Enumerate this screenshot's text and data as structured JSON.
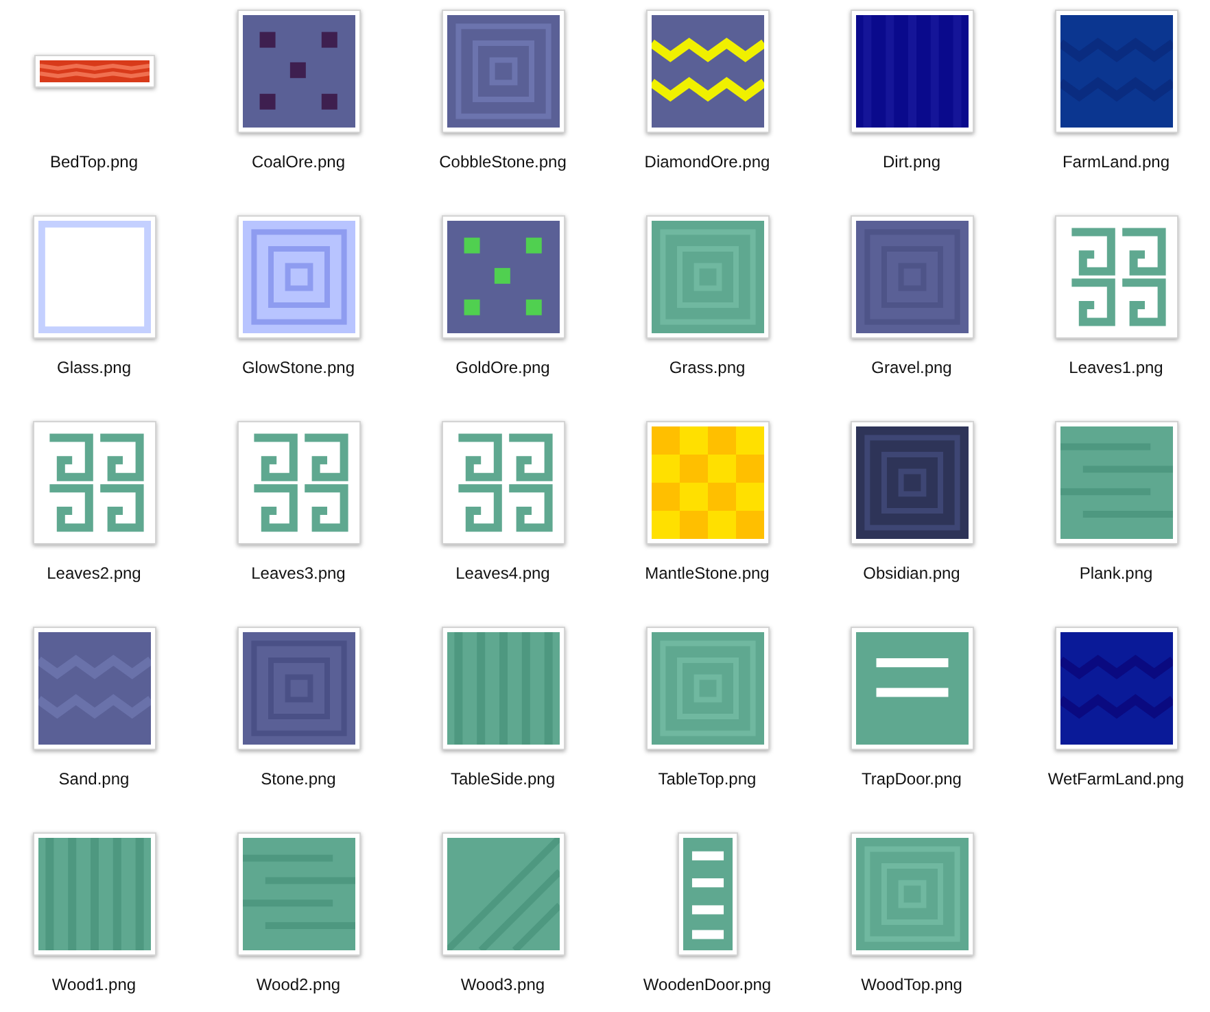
{
  "files": [
    {
      "name": "BedTop.png",
      "kind": "picture"
    },
    {
      "name": "CoalOre.png",
      "kind": "picture"
    },
    {
      "name": "CobbleStone.png",
      "kind": "picture"
    },
    {
      "name": "DiamondOre.png",
      "kind": "picture"
    },
    {
      "name": "Dirt.png",
      "kind": "picture"
    },
    {
      "name": "FarmLand.png",
      "kind": "picture"
    },
    {
      "name": "Glass.png",
      "kind": "picture"
    },
    {
      "name": "GlowStone.png",
      "kind": "picture"
    },
    {
      "name": "GoldOre.png",
      "kind": "picture"
    },
    {
      "name": "Grass.png",
      "kind": "picture"
    },
    {
      "name": "Gravel.png",
      "kind": "picture"
    },
    {
      "name": "Leaves1.png",
      "kind": "picture"
    },
    {
      "name": "Leaves2.png",
      "kind": "picture"
    },
    {
      "name": "Leaves3.png",
      "kind": "picture"
    },
    {
      "name": "Leaves4.png",
      "kind": "picture"
    },
    {
      "name": "MantleStone.png",
      "kind": "picture"
    },
    {
      "name": "Obsidian.png",
      "kind": "picture"
    },
    {
      "name": "Plank.png",
      "kind": "picture"
    },
    {
      "name": "Sand.png",
      "kind": "picture"
    },
    {
      "name": "Stone.png",
      "kind": "picture"
    },
    {
      "name": "TableSide.png",
      "kind": "picture"
    },
    {
      "name": "TableTop.png",
      "kind": "picture"
    },
    {
      "name": "TrapDoor.png",
      "kind": "picture"
    },
    {
      "name": "WetFarmLand.png",
      "kind": "picture"
    },
    {
      "name": "Wood1.png",
      "kind": "picture"
    },
    {
      "name": "Wood2.png",
      "kind": "picture"
    },
    {
      "name": "Wood3.png",
      "kind": "picture"
    },
    {
      "name": "WoodenDoor.png",
      "kind": "picture"
    },
    {
      "name": "WoodTop.png",
      "kind": "picture"
    }
  ]
}
